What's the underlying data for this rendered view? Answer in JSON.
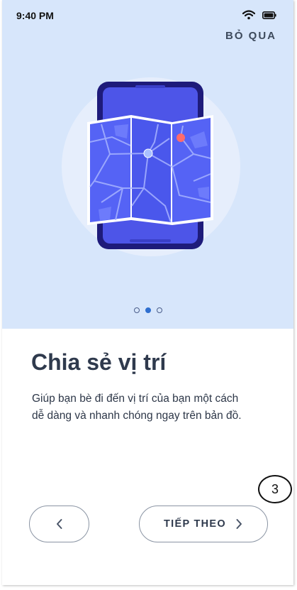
{
  "status_bar": {
    "time": "9:40 PM"
  },
  "header": {
    "skip_label": "BỎ QUA"
  },
  "pager": {
    "total": 3,
    "active_index": 1
  },
  "content": {
    "title": "Chia sẻ vị trí",
    "description": "Giúp bạn bè đi đến vị trí của bạn một cách dễ dàng và nhanh chóng ngay trên bản đồ."
  },
  "annotation": {
    "step_number": "3"
  },
  "buttons": {
    "next_label": "TIẾP THEO"
  },
  "icons": {
    "wifi": "wifi-icon",
    "battery": "battery-icon",
    "back": "chevron-left-icon",
    "next": "chevron-right-icon",
    "illustration": "phone-map-illustration"
  },
  "colors": {
    "hero_background": "#d7e6fb",
    "phone_body": "#1e1b7a",
    "phone_screen": "#4d55e8",
    "map_fill": "#5563f5",
    "map_pin": "#ff6b6b",
    "dot_active": "#2f6fcf",
    "text_dark": "#2f3a4d"
  }
}
